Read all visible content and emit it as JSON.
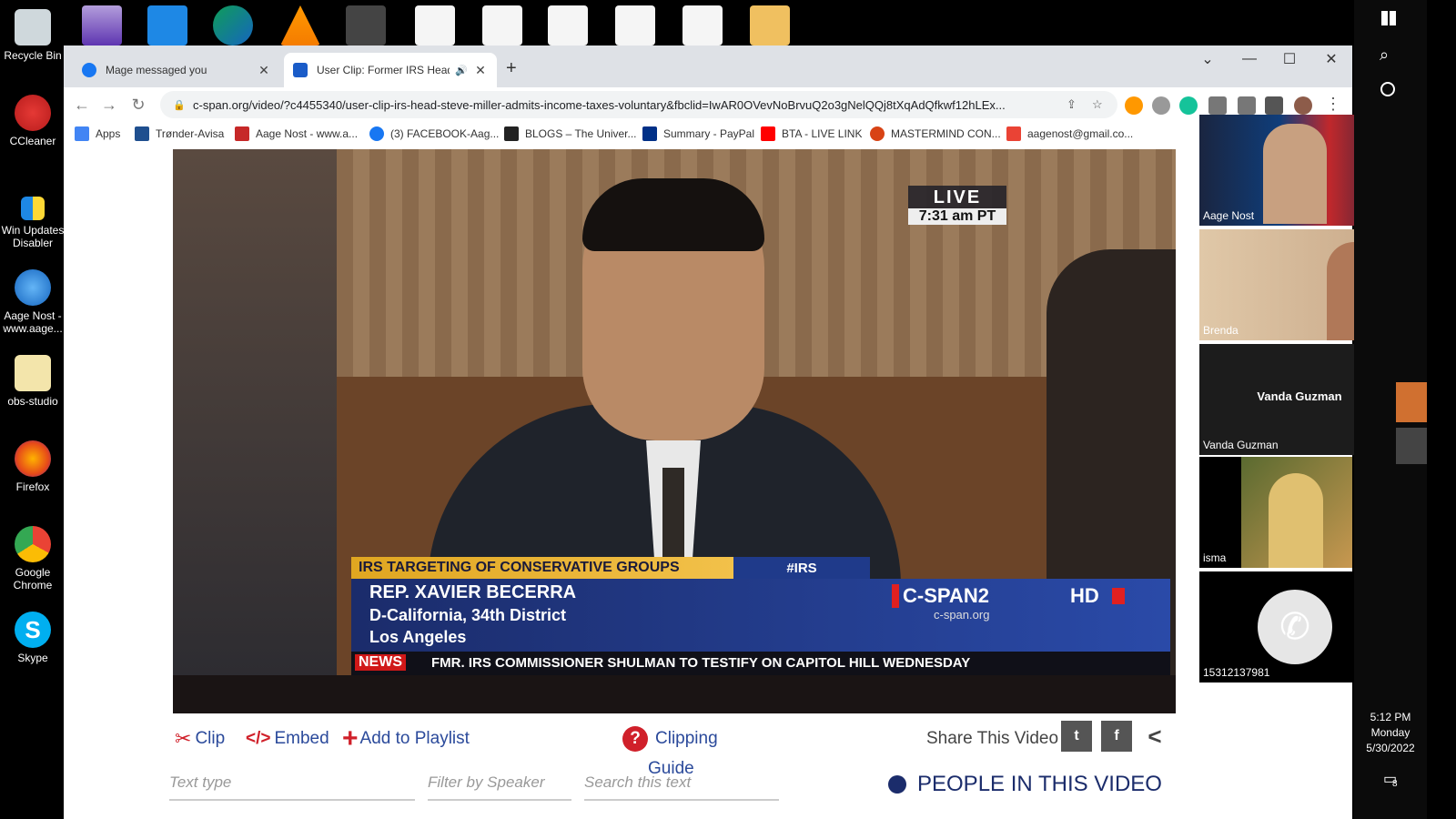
{
  "desktop": {
    "icons": [
      {
        "label": "Recycle Bin",
        "icon": "recycle-bin-icon"
      },
      {
        "label": "CCleaner",
        "icon": "ccleaner-icon"
      },
      {
        "label": "Win Updates Disabler",
        "icon": "shield-icon"
      },
      {
        "label": "Aage Nost - www.aage...",
        "icon": "chrome-shortcut-icon"
      },
      {
        "label": "obs-studio",
        "icon": "folder-icon"
      },
      {
        "label": "Firefox",
        "icon": "firefox-icon"
      },
      {
        "label": "Google Chrome",
        "icon": "chrome-icon"
      },
      {
        "label": "Skype",
        "icon": "skype-icon"
      }
    ]
  },
  "browser": {
    "tabs": [
      {
        "title": "Mage messaged you",
        "icon": "facebook-icon"
      },
      {
        "title": "User Clip: Former IRS Head S",
        "icon": "cspan-icon"
      }
    ],
    "url": "c-span.org/video/?c4455340/user-clip-irs-head-steve-miller-admits-income-taxes-voluntary&fbclid=IwAR0OVevNoBrvuQ2o3gNelQQj8tXqAdQfkwf12hLEx...",
    "bookmarks": [
      {
        "label": "Apps",
        "color": "#4285f4"
      },
      {
        "label": "Trønder-Avisa",
        "color": "#1f4f8f"
      },
      {
        "label": "Aage Nost - www.a...",
        "color": "#c62828"
      },
      {
        "label": "(3) FACEBOOK-Aag...",
        "color": "#1877f2"
      },
      {
        "label": "BLOGS – The Univer...",
        "color": "#222222"
      },
      {
        "label": "Summary - PayPal",
        "color": "#003087"
      },
      {
        "label": "BTA - LIVE LINK",
        "color": "#ff0000"
      },
      {
        "label": "MASTERMIND CON...",
        "color": "#d84315"
      },
      {
        "label": "aagenost@gmail.co...",
        "color": "#ea4335"
      }
    ]
  },
  "video": {
    "live": "LIVE",
    "time": "7:31 am PT",
    "banner": "IRS TARGETING OF CONSERVATIVE GROUPS",
    "hashtag": "#IRS",
    "name": "REP. XAVIER BECERRA",
    "district": "D-California, 34th District",
    "city": "Los Angeles",
    "network": "C-SPAN2",
    "site": "c-span.org",
    "hd": "HD",
    "news_label": "NEWS",
    "ticker": "FMR. IRS COMMISSIONER SHULMAN TO TESTIFY ON CAPITOL HILL WEDNESDAY"
  },
  "controls": {
    "clip": "Clip",
    "embed": "Embed",
    "playlist": "Add to Playlist",
    "guide1": "Clipping",
    "guide2": "Guide",
    "share": "Share This Video",
    "text_type": "Text type",
    "filter_speaker": "Filter by Speaker",
    "search": "Search this text",
    "people": "PEOPLE IN THIS VIDEO"
  },
  "participants": [
    {
      "name": "Aage Nost"
    },
    {
      "name": "Brenda"
    },
    {
      "name": "Vanda Guzman",
      "center": "Vanda Guzman"
    },
    {
      "name": "isma"
    },
    {
      "name": "15312137981"
    }
  ],
  "clock": {
    "time": "5:12 PM",
    "day": "Monday",
    "date": "5/30/2022"
  },
  "notifications": "8"
}
